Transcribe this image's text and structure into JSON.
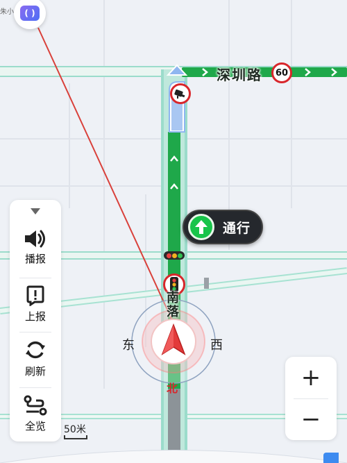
{
  "map": {
    "street_name": "深圳路",
    "speed_limit": "60",
    "vertical_road_name": "南落",
    "compass": {
      "east": "东",
      "west": "西",
      "north": "北"
    },
    "traffic_light": {
      "status": "通行"
    }
  },
  "side_toolbar": {
    "items": [
      {
        "label": "播报",
        "icon": "speaker-icon"
      },
      {
        "label": "上报",
        "icon": "report-icon"
      },
      {
        "label": "刷新",
        "icon": "refresh-icon"
      },
      {
        "label": "全览",
        "icon": "route-overview-icon"
      }
    ]
  },
  "zoom": {
    "in_label": "+",
    "out_label": "−"
  },
  "scale": {
    "label": "50米"
  },
  "top_left": {
    "text": "朱小"
  },
  "colors": {
    "route_green": "#1fa84a",
    "route_blue": "#8fb6f0",
    "warning_red": "#d8262b",
    "map_bg": "#eef1f6",
    "road_edge": "#9bdccb"
  }
}
